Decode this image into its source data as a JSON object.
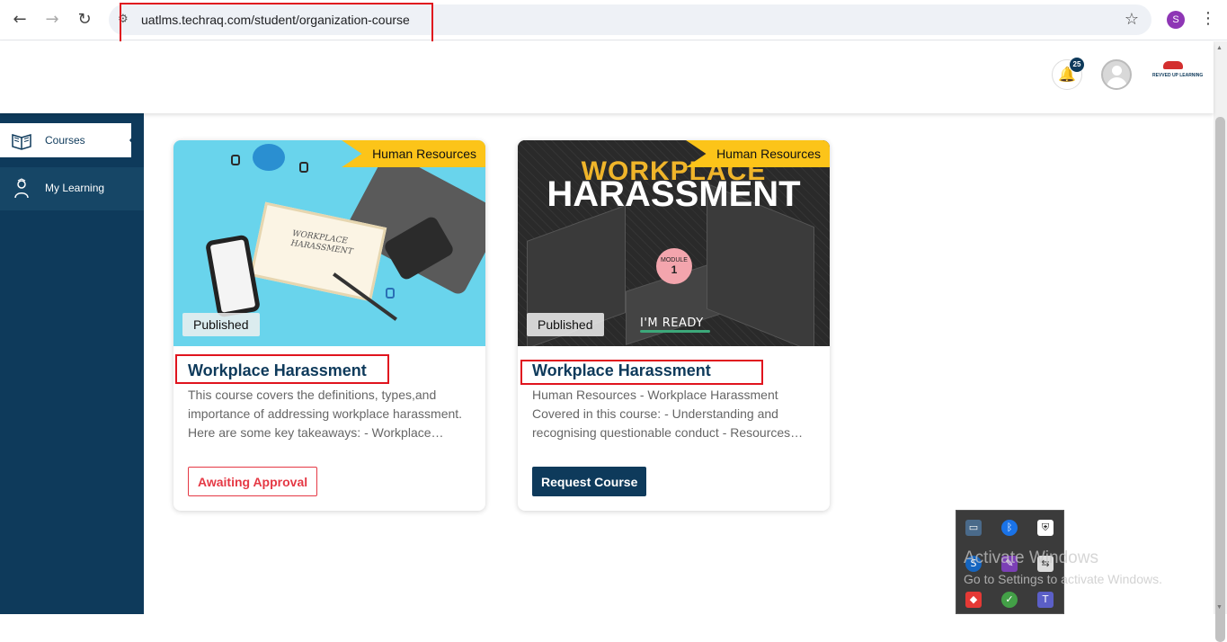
{
  "browser": {
    "url": "uatlms.techraq.com/student/organization-course",
    "profile_initial": "S",
    "nav_icons": [
      "back-icon",
      "forward-icon",
      "reload-icon",
      "site-settings-icon",
      "bookmark-star-icon",
      "kebab-menu-icon"
    ]
  },
  "header": {
    "notification_count": "25",
    "brand_text": "REVVED UP LEARNING"
  },
  "sidebar": {
    "items": [
      {
        "label": "Courses",
        "icon": "book-icon",
        "active": true
      },
      {
        "label": "My Learning",
        "icon": "learner-icon",
        "active": false
      }
    ]
  },
  "courses": [
    {
      "category": "Human Resources",
      "status": "Published",
      "title": "Workplace Harassment",
      "description": "This course covers the definitions, types,and importance of addressing workplace harassment. Here are some key takeaways: - Workplace…",
      "action_label": "Awaiting Approval",
      "thumb_text": [
        "WORKPLACE",
        "HARASSMENT"
      ]
    },
    {
      "category": "Human Resources",
      "status": "Published",
      "title": "Workplace Harassment",
      "description": "Human Resources - Workplace Harassment Covered in this course: - Understanding and recognising questionable conduct - Resources…",
      "action_label": "Request Course",
      "thumb_title_1": "WORKPLACE",
      "thumb_title_2": "HARASSMENT",
      "thumb_module_label": "MODULE",
      "thumb_module_number": "1",
      "thumb_tagline": "I'M READY"
    }
  ],
  "overlay": {
    "watermark_title": "Activate Windows",
    "watermark_sub": "Go to Settings to activate Windows."
  },
  "colors": {
    "primary": "#0e3a5b",
    "ribbon": "#fcc419",
    "danger": "#e53945",
    "annotation_red": "#e0141e"
  }
}
